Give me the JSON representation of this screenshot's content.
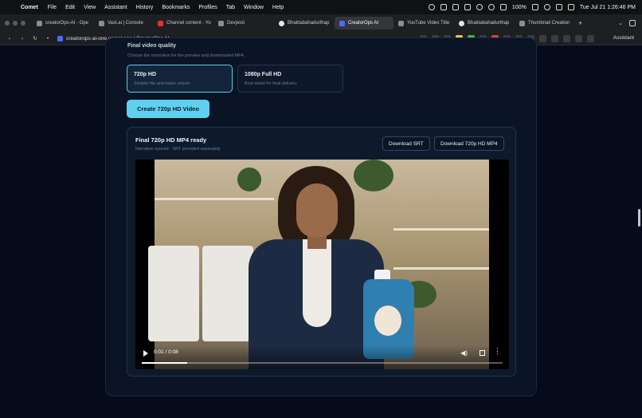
{
  "menubar": {
    "app": "Comet",
    "items": [
      "File",
      "Edit",
      "View",
      "Assistant",
      "History",
      "Bookmarks",
      "Profiles",
      "Tab",
      "Window",
      "Help"
    ],
    "battery": "100%",
    "clock": "Tue Jul 21  1:26:46 PM"
  },
  "tabs": [
    {
      "label": "creatorOps-AI - Ope",
      "icon": "generic-icon"
    },
    {
      "label": "Vast.ai | Console",
      "icon": "generic-icon"
    },
    {
      "label": "Channel content - Yo",
      "icon": "youtube-icon"
    },
    {
      "label": "Devpost",
      "icon": "generic-icon"
    },
    {
      "label": "Bhaktabahadurthap",
      "icon": "github-icon"
    },
    {
      "label": "CreatorOps AI",
      "icon": "creatorops-icon"
    },
    {
      "label": "YouTube Video Title",
      "icon": "generic-icon"
    },
    {
      "label": "Bhaktabahadurthap",
      "icon": "github-icon"
    },
    {
      "label": "Thumbnail Creation",
      "icon": "generic-icon"
    }
  ],
  "address": {
    "url": "creatorops-ai-one.vercel.app / CreatorOps AI",
    "assistant": "Assistant"
  },
  "quality": {
    "title": "Final video quality",
    "subtitle": "Choose the resolution for the preview and downloaded MP4.",
    "options": [
      {
        "title": "720p HD",
        "desc": "Smaller file and faster export",
        "selected": true
      },
      {
        "title": "1080p Full HD",
        "desc": "Best detail for final delivery",
        "selected": false
      }
    ]
  },
  "create_button": "Create 720p HD Video",
  "result": {
    "title": "Final 720p HD MP4 ready",
    "subtitle": "Narration synced · SRT provided separately",
    "download_srt": "Download SRT",
    "download_mp4": "Download 720p HD MP4"
  },
  "video": {
    "time": "0:01 / 0:08",
    "progress_fraction": 0.125
  }
}
